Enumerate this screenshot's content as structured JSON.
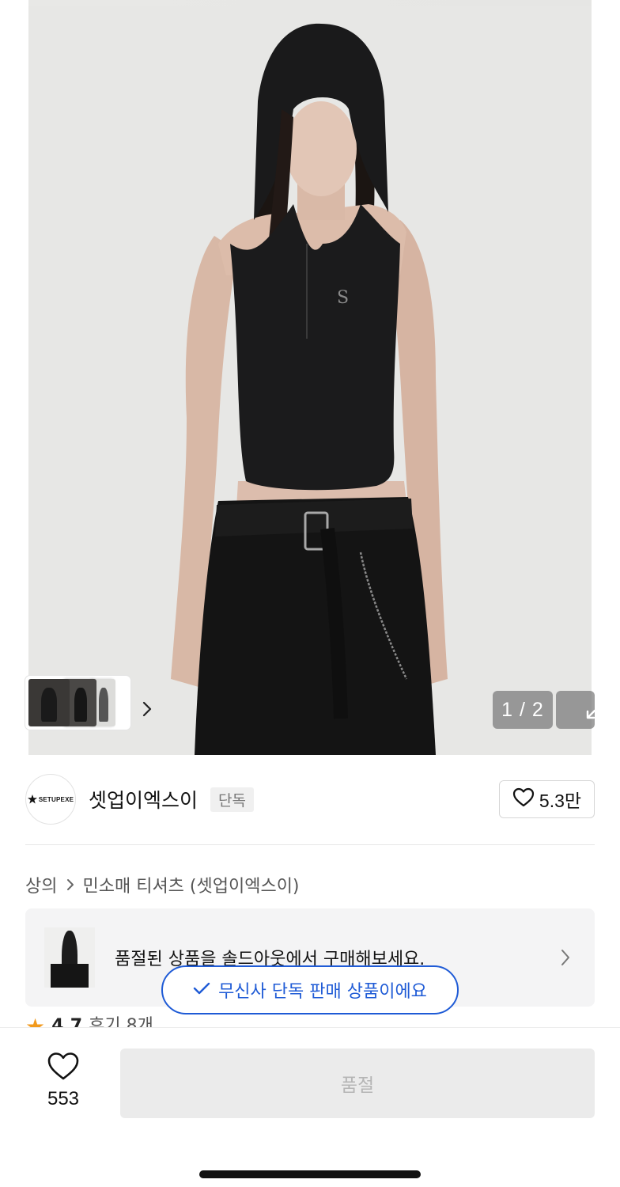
{
  "gallery": {
    "pager_text": "1 / 2"
  },
  "brand": {
    "logo_text": "SETUPEXE",
    "name": "셋업이엑스이",
    "badge": "단독",
    "likes": "5.3만"
  },
  "breadcrumb": {
    "category": "상의",
    "subcategory": "민소매 티셔츠 (셋업이엑스이)"
  },
  "soldout_banner": {
    "text": "품절된 상품을 솔드아웃에서 구매해보세요."
  },
  "exclusive_notice": {
    "text": "무신사 단독 판매 상품이에요"
  },
  "rating": {
    "score": "4.7",
    "reviews": "후기 8개"
  },
  "bottom_bar": {
    "wish_count": "553",
    "soldout_label": "품절"
  },
  "colors": {
    "accent_blue": "#1f5bd6",
    "star_orange": "#f29a1d",
    "disabled_button": "#ebebeb"
  },
  "icons": [
    "chevron-right-icon",
    "expand-icon",
    "heart-icon",
    "check-icon",
    "star-icon"
  ]
}
